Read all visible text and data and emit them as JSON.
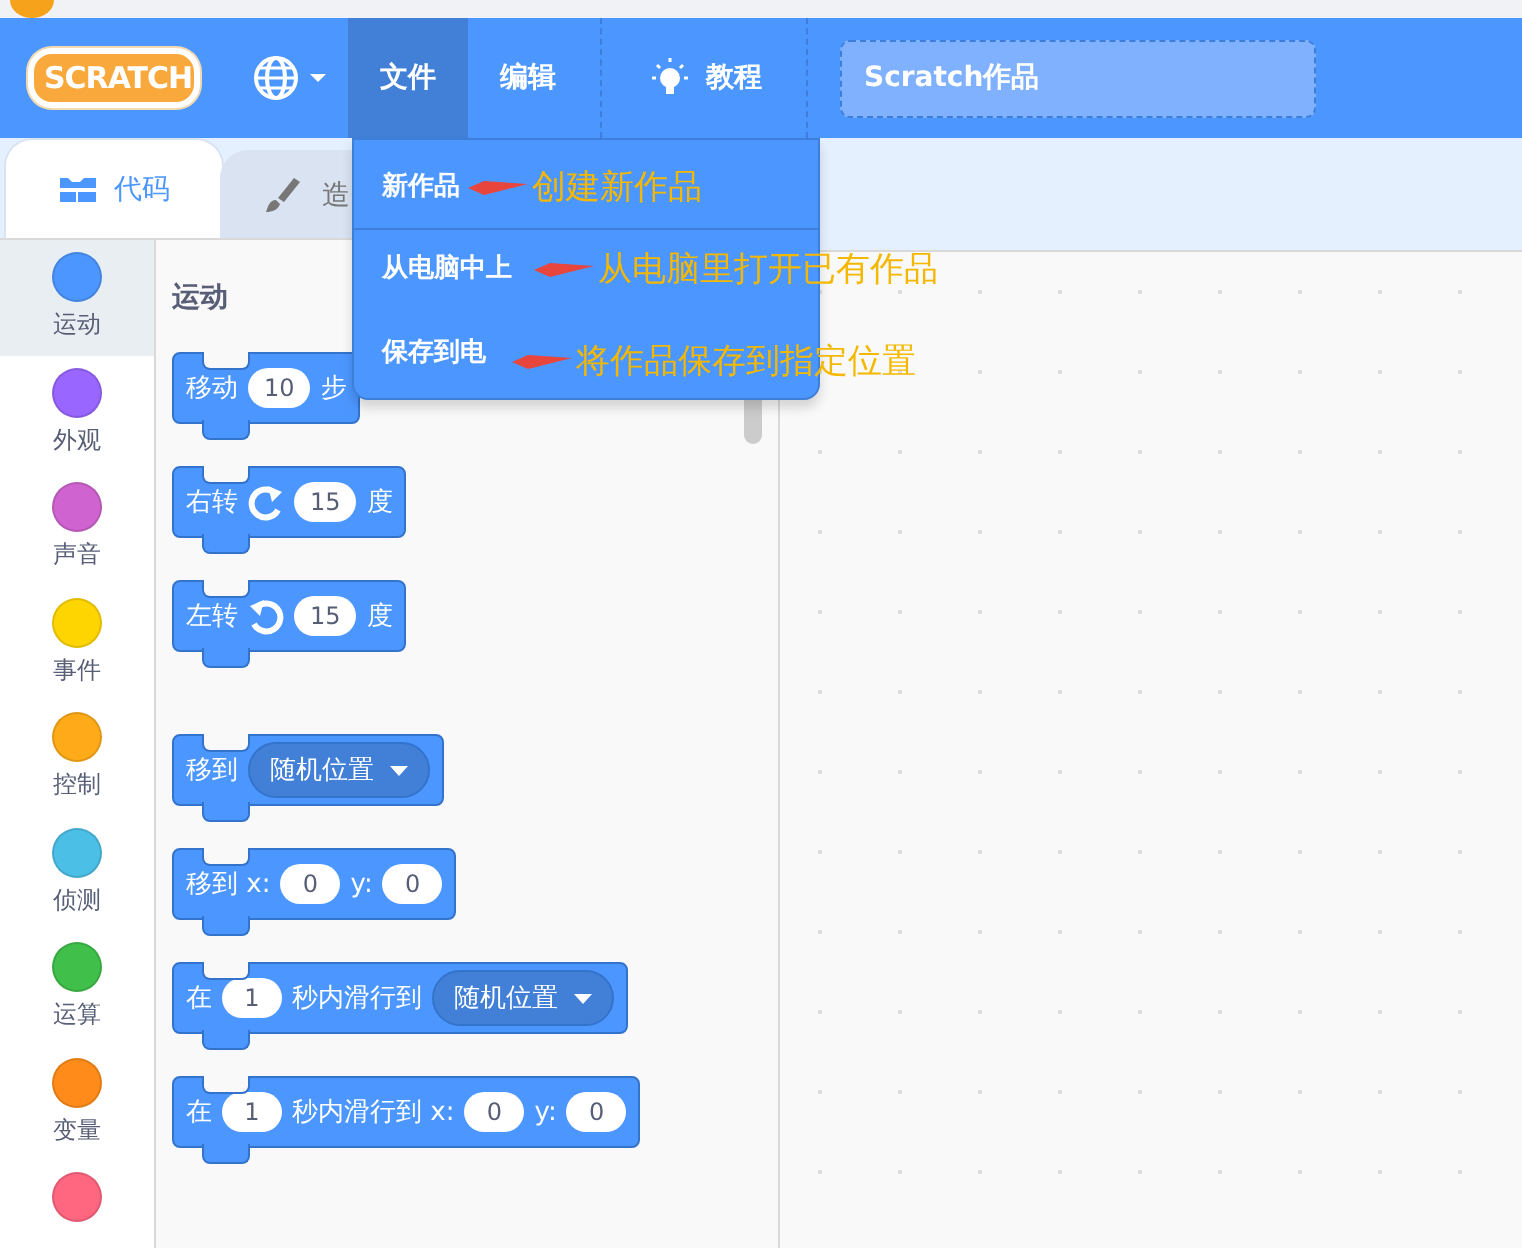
{
  "menu_bar": {
    "logo": "SCRATCH",
    "items": [
      {
        "label": "文件",
        "selected": true
      },
      {
        "label": "编辑",
        "selected": false
      },
      {
        "label": "教程",
        "selected": false,
        "kind": "tutorial"
      }
    ],
    "project_title": "Scratch作品"
  },
  "file_menu": {
    "items": [
      {
        "label": "新作品",
        "annotation": "创建新作品"
      },
      {
        "label": "从电脑中上",
        "annotation": "从电脑里打开已有作品"
      },
      {
        "label": "保存到电",
        "annotation": "将作品保存到指定位置"
      }
    ]
  },
  "tabs": [
    {
      "label": "代码",
      "selected": true,
      "kind": "code"
    },
    {
      "label": "造",
      "selected": false,
      "kind": "costume"
    }
  ],
  "categories": [
    {
      "label": "运动",
      "color": "#4c97ff",
      "selected": true
    },
    {
      "label": "外观",
      "color": "#9966ff",
      "selected": false
    },
    {
      "label": "声音",
      "color": "#cf63cf",
      "selected": false
    },
    {
      "label": "事件",
      "color": "#ffd500",
      "selected": false
    },
    {
      "label": "控制",
      "color": "#ffab19",
      "selected": false
    },
    {
      "label": "侦测",
      "color": "#4cbfe6",
      "selected": false
    },
    {
      "label": "运算",
      "color": "#40bf4a",
      "selected": false
    },
    {
      "label": "变量",
      "color": "#ff8c1a",
      "selected": false
    },
    {
      "color": "#ff6680",
      "selected": false
    }
  ],
  "palette": {
    "heading": "运动",
    "block_groups": [
      [
        {
          "parts": [
            {
              "kind": "text",
              "text": "移动"
            },
            {
              "kind": "number",
              "text": "10"
            },
            {
              "kind": "text",
              "text": "步"
            }
          ]
        },
        {
          "parts": [
            {
              "kind": "text",
              "text": "右转"
            },
            {
              "kind": "turn-right"
            },
            {
              "kind": "number",
              "text": "15"
            },
            {
              "kind": "text",
              "text": "度"
            }
          ]
        },
        {
          "parts": [
            {
              "kind": "text",
              "text": "左转"
            },
            {
              "kind": "turn-left"
            },
            {
              "kind": "number",
              "text": "15"
            },
            {
              "kind": "text",
              "text": "度"
            }
          ]
        }
      ],
      [
        {
          "parts": [
            {
              "kind": "text",
              "text": "移到"
            },
            {
              "kind": "dropdown",
              "text": "随机位置"
            }
          ]
        },
        {
          "parts": [
            {
              "kind": "text",
              "text": "移到 x:"
            },
            {
              "kind": "number",
              "text": "0"
            },
            {
              "kind": "text",
              "text": "y:"
            },
            {
              "kind": "number",
              "text": "0"
            }
          ]
        },
        {
          "parts": [
            {
              "kind": "text",
              "text": "在"
            },
            {
              "kind": "number",
              "text": "1"
            },
            {
              "kind": "text",
              "text": "秒内滑行到"
            },
            {
              "kind": "dropdown",
              "text": "随机位置"
            }
          ]
        },
        {
          "parts": [
            {
              "kind": "text",
              "text": "在"
            },
            {
              "kind": "number",
              "text": "1"
            },
            {
              "kind": "text",
              "text": "秒内滑行到 x:"
            },
            {
              "kind": "number",
              "text": "0"
            },
            {
              "kind": "text",
              "text": "y:"
            },
            {
              "kind": "number",
              "text": "0"
            }
          ]
        }
      ]
    ]
  }
}
